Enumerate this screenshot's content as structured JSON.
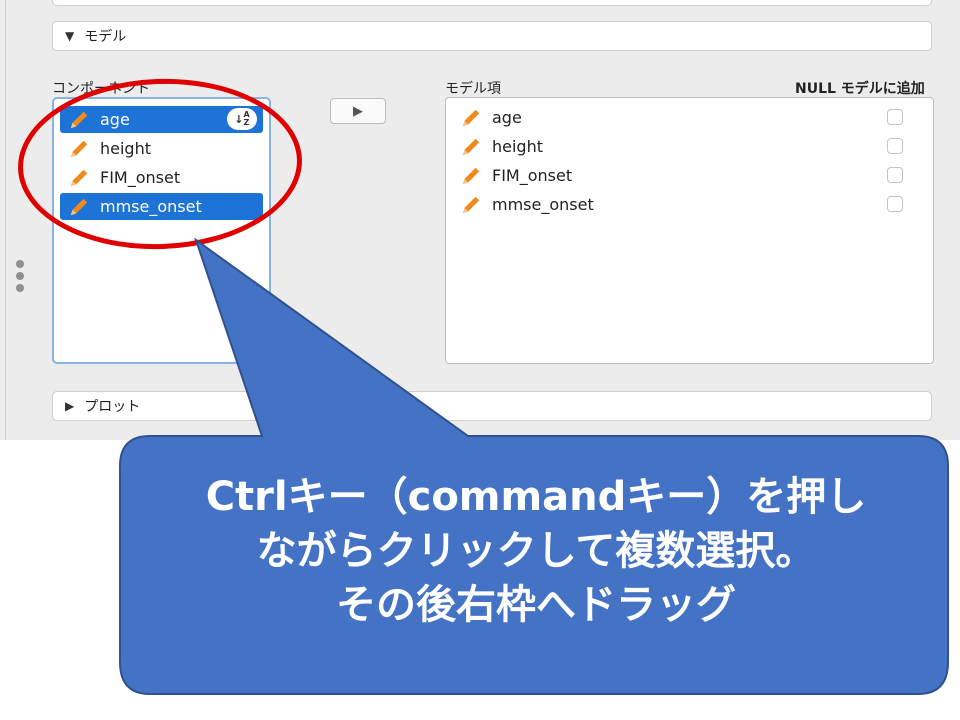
{
  "model_section": {
    "title": "モデル",
    "expanded_icon": "triangle-down-icon"
  },
  "components": {
    "label": "コンポーネント",
    "items": [
      {
        "name": "age",
        "selected": true,
        "icon": "pencil-icon"
      },
      {
        "name": "height",
        "selected": false,
        "icon": "pencil-icon"
      },
      {
        "name": "FIM_onset",
        "selected": false,
        "icon": "pencil-icon"
      },
      {
        "name": "mmse_onset",
        "selected": true,
        "icon": "pencil-icon"
      }
    ],
    "sort_icon": "sort-az-icon"
  },
  "move_button": {
    "icon": "play-arrow-icon",
    "glyph": "▶"
  },
  "model_terms": {
    "label": "モデル項",
    "null_label": "NULL モデルに追加",
    "items": [
      {
        "name": "age",
        "null_model": false
      },
      {
        "name": "height",
        "null_model": false
      },
      {
        "name": "FIM_onset",
        "null_model": false
      },
      {
        "name": "mmse_onset",
        "null_model": false
      }
    ]
  },
  "plot_section": {
    "title": "プロット",
    "collapsed_icon": "triangle-right-icon"
  },
  "callout": {
    "line1": "Ctrlキー（commandキー）を押し",
    "line2": "ながらクリックして複数選択。",
    "line3": "その後右枠へドラッグ",
    "fill_color": "#4472c4",
    "border_color": "#2f528f"
  },
  "highlight_color": "#e10000",
  "selection_color": "#1e73d6"
}
